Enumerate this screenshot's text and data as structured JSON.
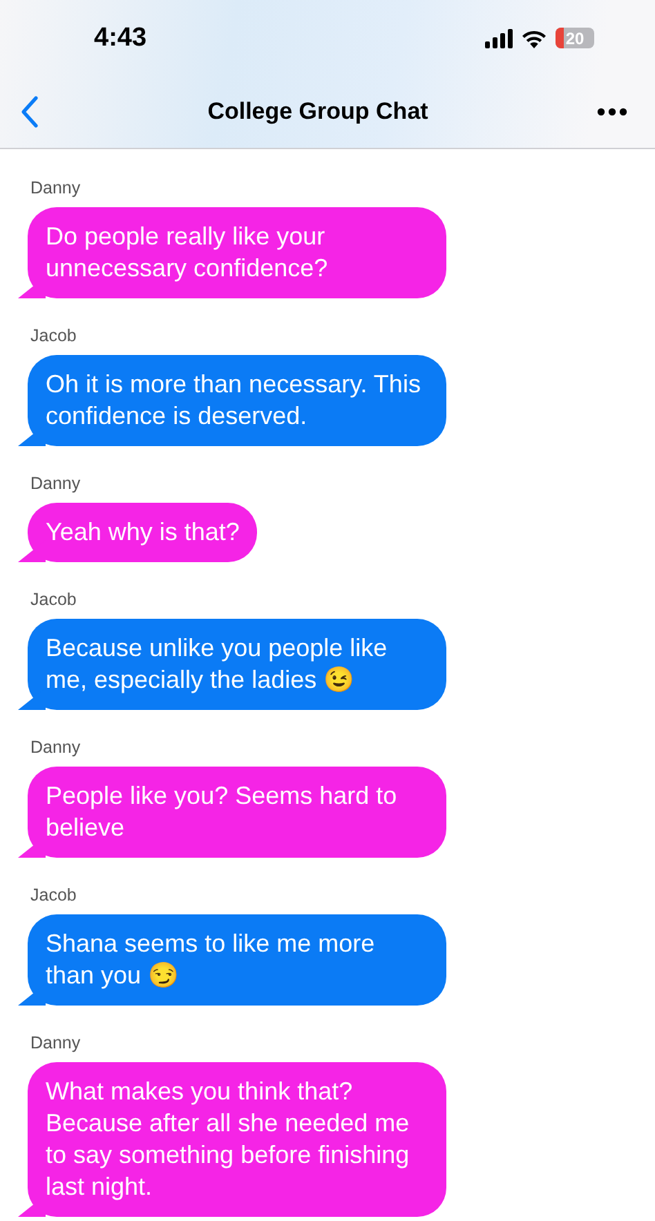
{
  "status_bar": {
    "time": "4:43",
    "battery": "20"
  },
  "nav_bar": {
    "title": "College Group Chat"
  },
  "messages": [
    {
      "sender": "Danny",
      "text": "Do people really like your unnecessary confidence?",
      "color": "#f524e6"
    },
    {
      "sender": "Jacob",
      "text": "Oh it is more than necessary. This confidence is deserved.",
      "color": "#0b7bf5"
    },
    {
      "sender": "Danny",
      "text": "Yeah why is that?",
      "color": "#f524e6"
    },
    {
      "sender": "Jacob",
      "text": "Because unlike you people like me, especially the ladies 😉",
      "color": "#0b7bf5"
    },
    {
      "sender": "Danny",
      "text": "People like you? Seems hard to believe",
      "color": "#f524e6"
    },
    {
      "sender": "Jacob",
      "text": "Shana seems to like me more than you 😏",
      "color": "#0b7bf5"
    },
    {
      "sender": "Danny",
      "text": "What makes you think that? Because after all she needed me to say something before finishing last night.",
      "color": "#f524e6"
    }
  ]
}
